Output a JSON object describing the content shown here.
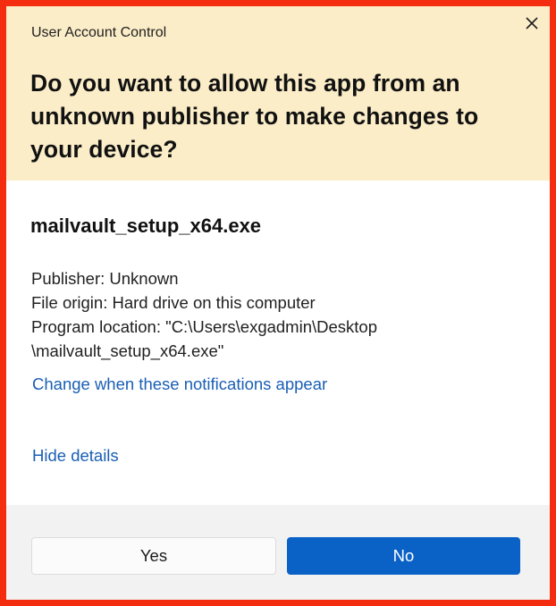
{
  "window": {
    "title": "User Account Control",
    "close_icon": "close-icon"
  },
  "header": {
    "question": "Do you want to allow this app from an unknown publisher to make changes to your device?"
  },
  "body": {
    "file_name": "mailvault_setup_x64.exe",
    "publisher": "Publisher: Unknown",
    "file_origin": "File origin: Hard drive on this computer",
    "program_location_line1": "Program location: \"C:\\Users\\exgadmin\\Desktop",
    "program_location_line2": "\\mailvault_setup_x64.exe\"",
    "change_notifications_link": "Change when these notifications appear",
    "hide_details_link": "Hide details"
  },
  "footer": {
    "yes_label": "Yes",
    "no_label": "No"
  },
  "colors": {
    "border": "#f42d10",
    "header_bg": "#fbedc8",
    "link": "#1a5fb4",
    "primary_button": "#0a62c7",
    "footer_bg": "#f2f2f2"
  }
}
